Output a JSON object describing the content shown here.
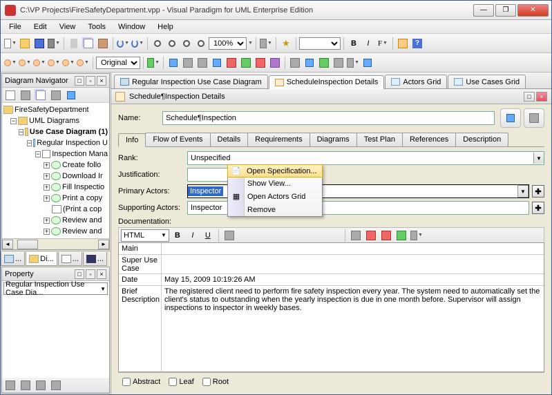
{
  "title": "C:\\VP Projects\\FireSafetyDepartment.vpp - Visual Paradigm for UML Enterprise Edition",
  "menu": {
    "file": "File",
    "edit": "Edit",
    "view": "View",
    "tools": "Tools",
    "window": "Window",
    "help": "Help"
  },
  "toolbar": {
    "zoom": "100%",
    "original": "Original",
    "bold": "B",
    "italic": "I",
    "font": "F"
  },
  "nav": {
    "title": "Diagram Navigator",
    "root": "FireSafetyDepartment",
    "uml": "UML Diagrams",
    "ucd": "Use Case Diagram (1)",
    "reg": "Regular Inspection U",
    "mana": "Inspection Mana",
    "items": [
      "Create follo",
      "Download Ir",
      "Fill Inspectio",
      "Print a copy",
      "(Print a cop",
      "Review and",
      "Review and"
    ]
  },
  "left_tabs": {
    "t1": "...",
    "t2": "Di...",
    "t3": "...",
    "t4": "..."
  },
  "prop": {
    "title": "Property",
    "combo": "Regular Inspection Use Case Dia..."
  },
  "editor_tabs": {
    "t1": "Regular Inspection Use Case Diagram",
    "t2": "ScheduleInspection Details",
    "t3": "Actors Grid",
    "t4": "Use Cases Grid"
  },
  "detail": {
    "header": "Schedule¶Inspection Details",
    "name_lbl": "Name:",
    "name_val": "Schedule¶Inspection"
  },
  "sub_tabs": {
    "info": "Info",
    "flow": "Flow of Events",
    "details": "Details",
    "req": "Requirements",
    "diag": "Diagrams",
    "tp": "Test Plan",
    "ref": "References",
    "desc": "Description"
  },
  "fields": {
    "rank_lbl": "Rank:",
    "rank_val": "Unspecified",
    "just_lbl": "Justification:",
    "pa_lbl": "Primary Actors:",
    "pa_val": "Inspector",
    "sa_lbl": "Supporting Actors:",
    "sa_val": "Inspector",
    "doc_lbl": "Documentation:",
    "html": "HTML"
  },
  "info_table": {
    "main": "Main",
    "super": "Super Use Case",
    "date_l": "Date",
    "brief_l": "Brief Description",
    "date_v": "May 15, 2009 10:19:26 AM",
    "brief_v": "The registered client need to perform fire safety inspection every year. The system need to automatically set the client's status to outstanding when the yearly inspection is due in one month before. Supervisor will assign inspections to inspector in weekly bases."
  },
  "context": {
    "open": "Open Specification...",
    "show": "Show View...",
    "grid": "Open Actors Grid",
    "remove": "Remove"
  },
  "footer": {
    "abstract": "Abstract",
    "leaf": "Leaf",
    "root": "Root"
  }
}
